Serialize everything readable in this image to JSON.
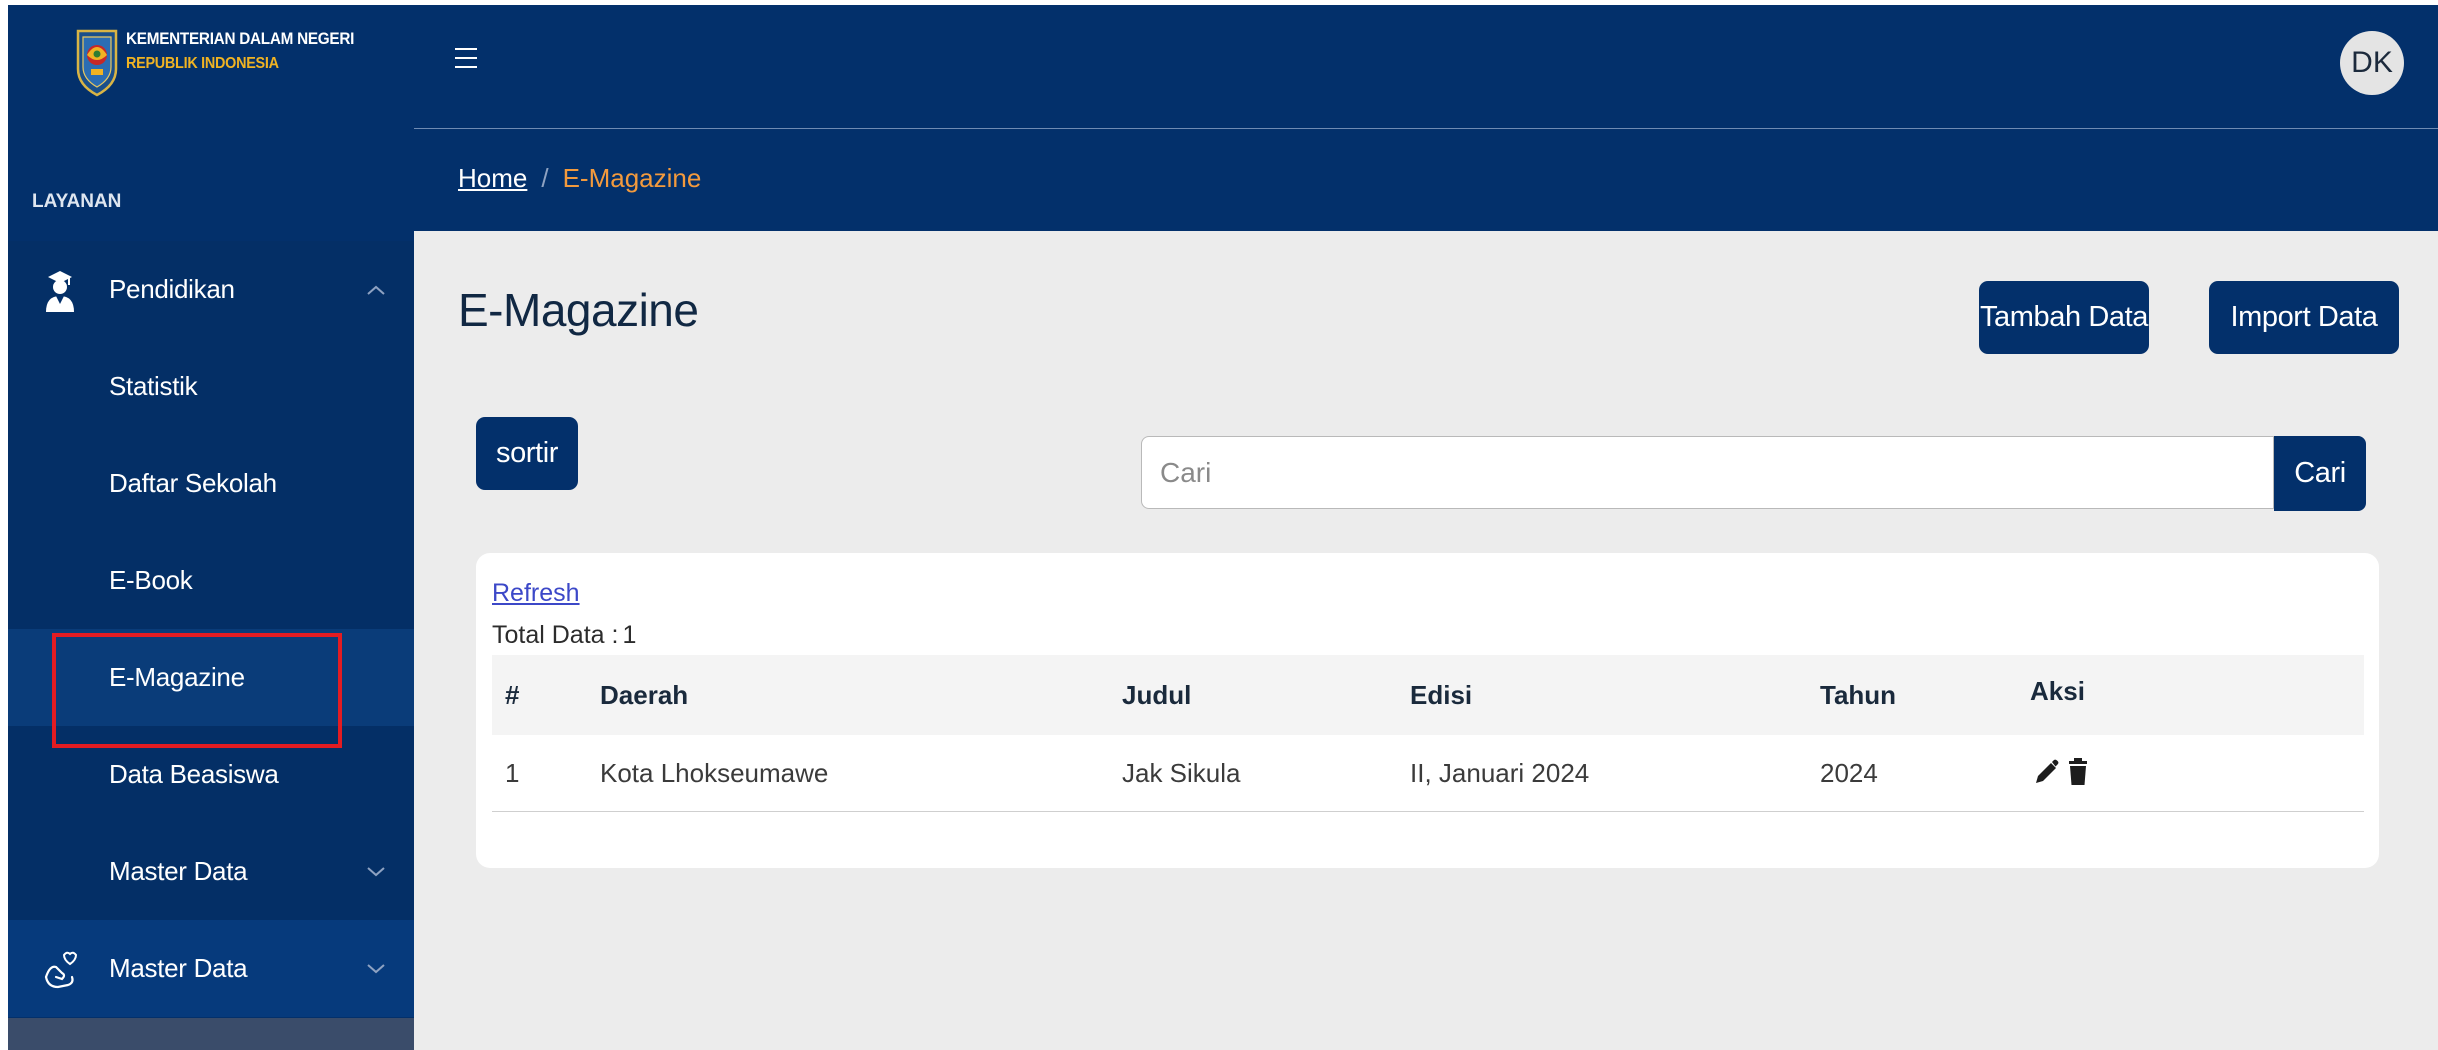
{
  "brand": {
    "line1": "KEMENTERIAN DALAM NEGERI",
    "line2": "REPUBLIK INDONESIA"
  },
  "sidebar": {
    "section_label": "LAYANAN",
    "items": [
      {
        "label": "Pendidikan",
        "icon": "graduate-icon",
        "chevron": "up"
      },
      {
        "label": "Statistik"
      },
      {
        "label": "Daftar Sekolah"
      },
      {
        "label": "E-Book"
      },
      {
        "label": "E-Magazine",
        "active": true
      },
      {
        "label": "Data Beasiswa"
      },
      {
        "label": "Master Data",
        "chevron": "down"
      },
      {
        "label": "Master Data",
        "icon": "hand-heart-icon",
        "chevron": "down"
      }
    ]
  },
  "header": {
    "menu_icon": "hamburger-icon",
    "avatar_initials": "DK"
  },
  "breadcrumb": {
    "home": "Home",
    "separator": "/",
    "current": "E-Magazine"
  },
  "main": {
    "title": "E-Magazine",
    "add_button": "Tambah Data",
    "import_button": "Import Data",
    "sort_button": "sortir",
    "search": {
      "placeholder": "Cari",
      "value": "",
      "button": "Cari"
    },
    "refresh_link": "Refresh",
    "total_label": "Total Data :",
    "total_value": "1",
    "table": {
      "columns": [
        "#",
        "Daerah",
        "Judul",
        "Edisi",
        "Tahun",
        "Aksi"
      ],
      "rows": [
        {
          "no": "1",
          "daerah": "Kota Lhokseumawe",
          "judul": "Jak Sikula",
          "edisi": "II, Januari 2024",
          "tahun": "2024",
          "actions": [
            "pencil-icon",
            "trash-icon"
          ]
        }
      ]
    }
  },
  "colors": {
    "primary": "#03306b",
    "accent_orange": "#f39a3d",
    "brand_gold": "#f0b323",
    "highlight_red": "#e31c22",
    "background": "#ececec"
  }
}
